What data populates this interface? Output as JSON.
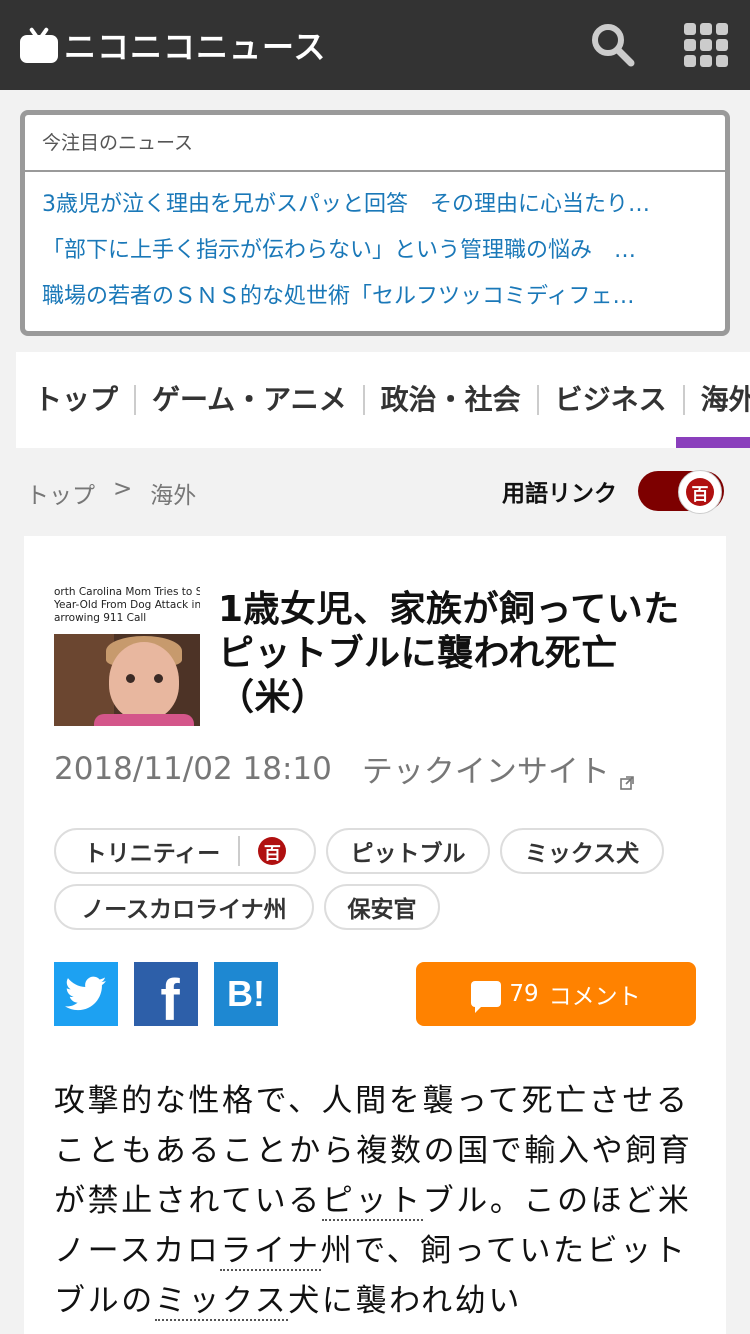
{
  "header": {
    "logo_text": "ニコニコニュース",
    "search_icon": "search-icon",
    "apps_icon": "grid-icon"
  },
  "trending": {
    "title": "今注目のニュース",
    "items": [
      "3歳児が泣く理由を兄がスパッと回答　その理由に心当たり…",
      "「部下に上手く指示が伝わらない」という管理職の悩み　…",
      "職場の若者のＳＮＳ的な処世術「セルフツッコミディフェ…"
    ]
  },
  "categories": [
    "トップ",
    "ゲーム・アニメ",
    "政治・社会",
    "ビジネス",
    "海外"
  ],
  "breadcrumb": {
    "top": "トップ",
    "sep": ">",
    "current": "海外"
  },
  "term_link": {
    "label": "用語リンク",
    "icon_char": "百",
    "enabled": true
  },
  "article": {
    "thumb_caption": [
      "orth Carolina Mom Tries to Save",
      "Year-Old From Dog Attack in",
      "arrowing 911 Call"
    ],
    "title": "1歳女児、家族が飼っていたピットブルに襲われ死亡（米）",
    "date": "2018/11/02 18:10",
    "source": "テックインサイト",
    "tags": [
      "トリニティー",
      "ピットブル",
      "ミックス犬",
      "ノースカロライナ州",
      "保安官"
    ],
    "tag_dic_icon": "百",
    "share": {
      "twitter": "twitter-icon",
      "facebook": "f",
      "hatena": "B!"
    },
    "comment_count": "79",
    "comment_label": "コメント",
    "body": {
      "p1": "攻撃的な性格で、人間を襲って死亡させることもあることから複数の国で輸入や飼育が禁止されている",
      "term1": "ピット",
      "p2": "ブル。このほど米ノースカロ",
      "term2": "ライナ",
      "p3": "州で、飼っていたビットブルの",
      "term3": "ミックス",
      "p4": "犬に襲われ幼い"
    }
  },
  "colors": {
    "header_bg": "#333333",
    "link": "#1a78b8",
    "accent_purple": "#8a3fbc",
    "toggle_on": "#7d0000",
    "twitter": "#1da1f2",
    "facebook": "#2d5fa9",
    "hatena": "#1e88d2",
    "comment_btn": "#ff8200"
  }
}
